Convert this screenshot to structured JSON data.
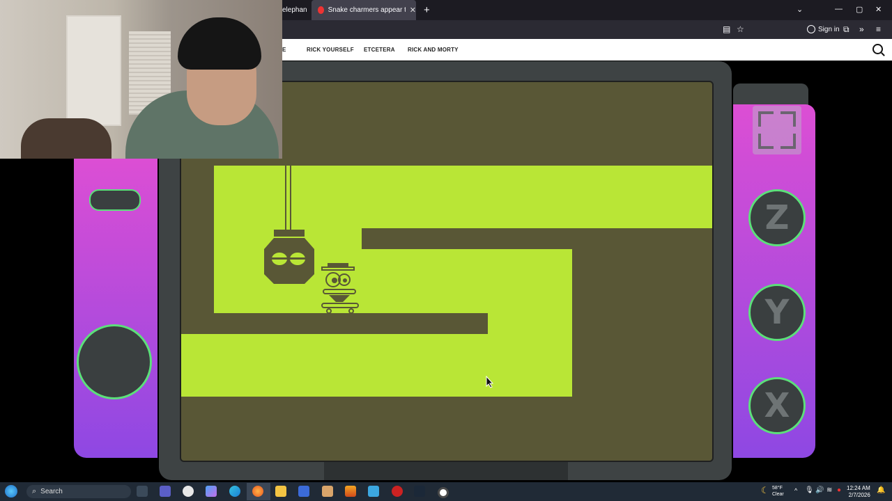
{
  "browser": {
    "tabs": [
      {
        "title": "elephan",
        "active": false
      },
      {
        "title": "Snake charmers appear to hypn",
        "active": true
      }
    ],
    "new_tab_symbol": "+",
    "sign_in_label": "Sign in",
    "window_controls": [
      "—",
      "▢",
      "✕"
    ]
  },
  "site_nav": {
    "items": [
      "E",
      "RICK YOURSELF",
      "ETCETERA",
      "RICK AND MORTY"
    ],
    "search_icon": "search-icon"
  },
  "game": {
    "buttons": [
      "Z",
      "Y",
      "X"
    ],
    "palette": {
      "lime": "#b9e636",
      "dark": "#595736",
      "button_ring": "#5ce07a",
      "panel_top": "#dc4ed4",
      "panel_bottom": "#8e48e3"
    }
  },
  "taskbar": {
    "search_placeholder": "Search",
    "weather_temp": "58°F",
    "weather_desc": "Clear",
    "time": "12:24 AM",
    "date": "2/7/2026"
  }
}
